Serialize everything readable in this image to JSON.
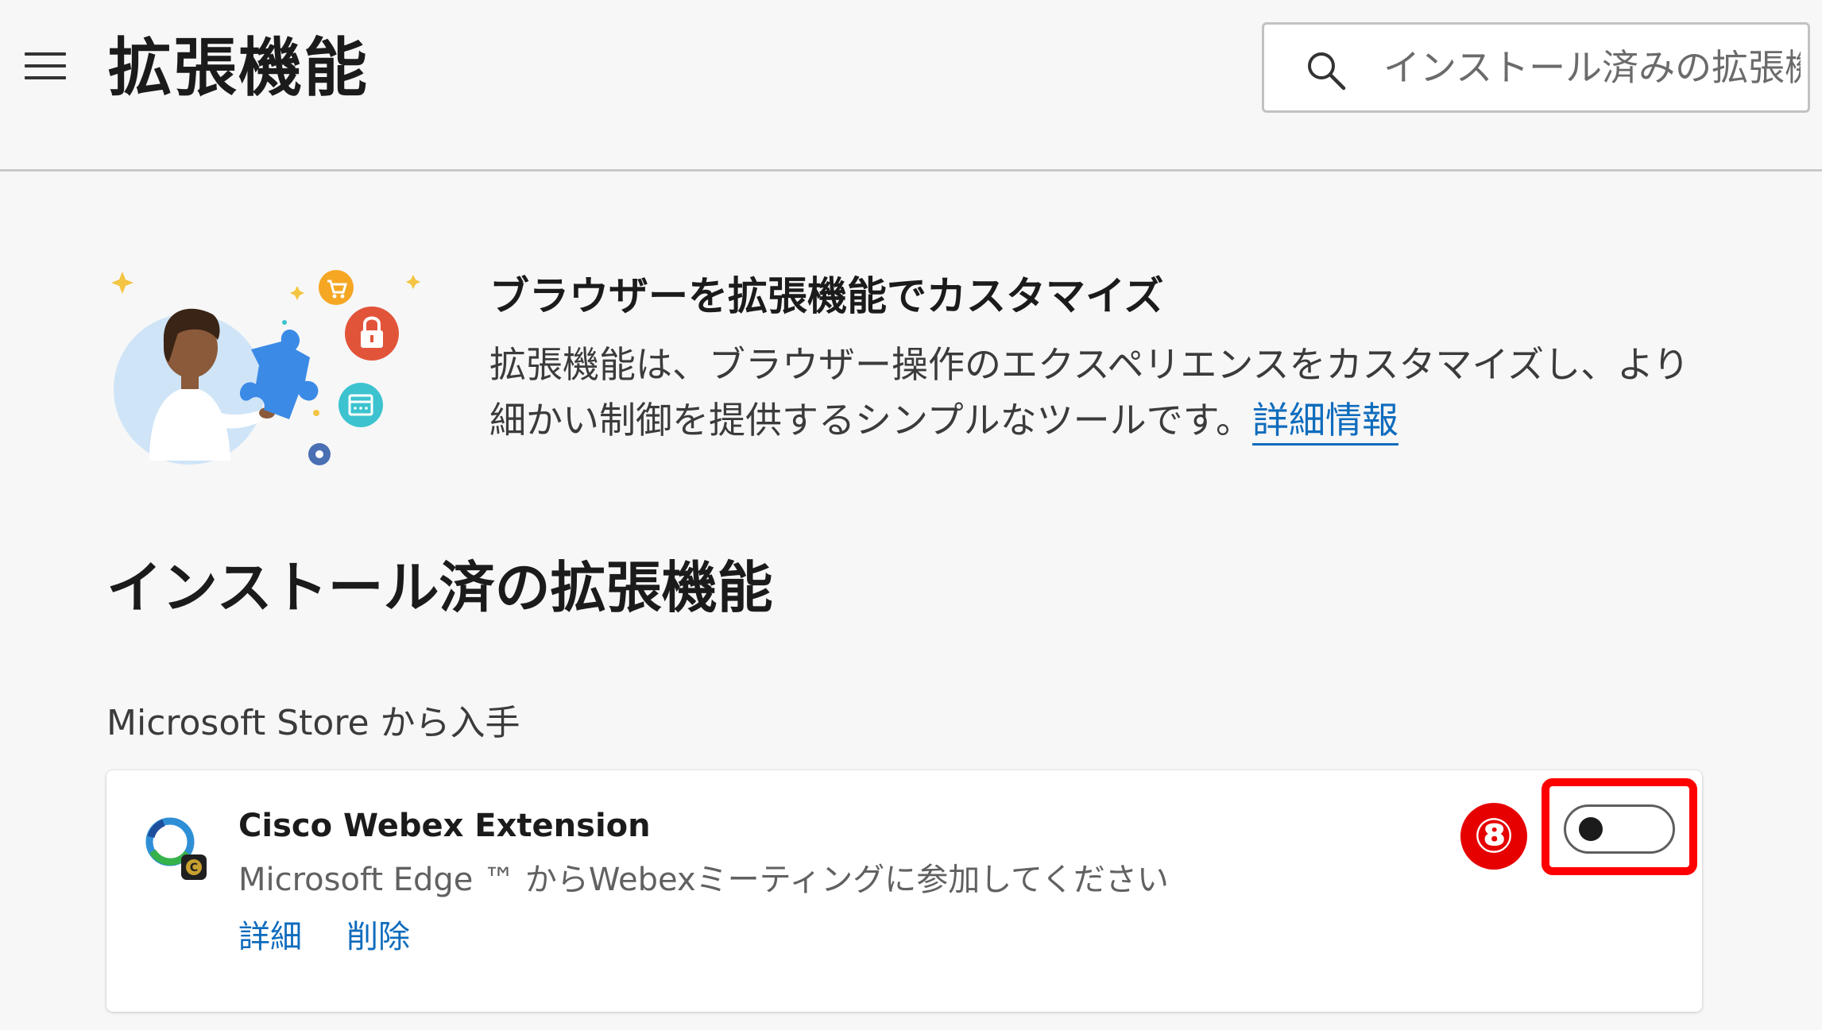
{
  "header": {
    "title": "拡張機能",
    "search": {
      "placeholder": "インストール済みの拡張機...",
      "value": ""
    }
  },
  "hero": {
    "title": "ブラウザーを拡張機能でカスタマイズ",
    "description": "拡張機能は、ブラウザー操作のエクスペリエンスをカスタマイズし、より細かい制御を提供するシンプルなツールです。",
    "learn_more": "詳細情報"
  },
  "installed": {
    "section_title": "インストール済の拡張機能",
    "source_label": "Microsoft Store から入手",
    "extensions": [
      {
        "name": "Cisco Webex Extension",
        "description": "Microsoft Edge ™ からWebexミーティングに参加してください",
        "details_label": "詳細",
        "remove_label": "削除",
        "enabled": false
      }
    ]
  },
  "annotation": {
    "step_number": "⑧",
    "color": "#ff0000"
  },
  "colors": {
    "background": "#f7f7f7",
    "link": "#0f6cbd",
    "text": "#1b1b1b"
  },
  "icons": [
    "menu-icon",
    "search-icon",
    "cisco-webex-icon"
  ]
}
